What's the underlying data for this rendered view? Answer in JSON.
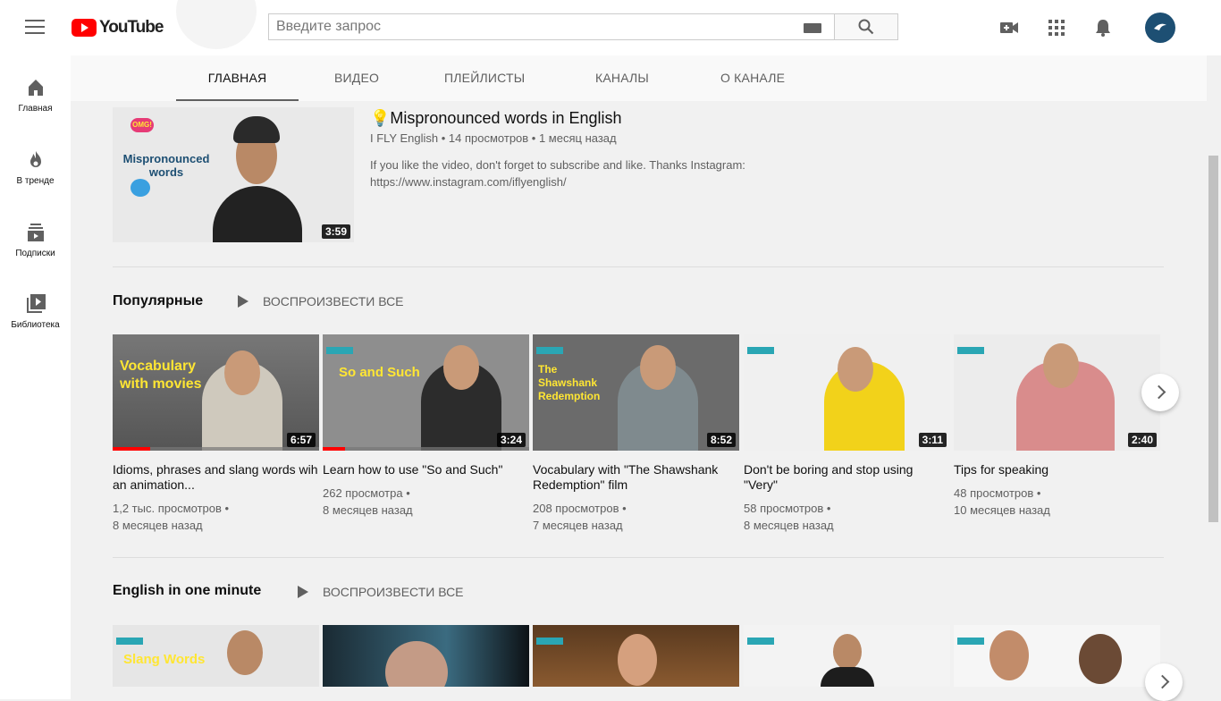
{
  "header": {
    "logo_text": "YouTube",
    "search_placeholder": "Введите запрос",
    "icons": [
      "menu-icon",
      "keyboard-icon",
      "search-icon",
      "create-video-icon",
      "apps-icon",
      "notifications-icon",
      "avatar"
    ]
  },
  "sidebar": {
    "items": [
      {
        "label": "Главная",
        "icon": "home-icon"
      },
      {
        "label": "В тренде",
        "icon": "fire-icon"
      },
      {
        "label": "Подписки",
        "icon": "subscriptions-icon"
      },
      {
        "label": "Библиотека",
        "icon": "library-icon"
      }
    ]
  },
  "tabs": [
    "ГЛАВНАЯ",
    "ВИДЕО",
    "ПЛЕЙЛИСТЫ",
    "КАНАЛЫ",
    "О КАНАЛЕ"
  ],
  "featured": {
    "title": "💡Mispronounced words in English",
    "channel": "I FLY English",
    "views": "14 просмотров",
    "age": "1 месяц назад",
    "description": "If you like the video, don't forget to subscribe and like. Thanks Instagram: https://www.instagram.com/iflyenglish/",
    "duration": "3:59",
    "thumb_caption": "Mispronounced words",
    "thumb_badge": "OMG!"
  },
  "shelves": [
    {
      "title": "Популярные",
      "play_all": "ВОСПРОИЗВЕСТИ ВСЕ",
      "videos": [
        {
          "title": "Idioms, phrases and slang words wih an animation...",
          "views": "1,2 тыс. просмотров",
          "age": "8 месяцев назад",
          "duration": "6:57",
          "caption": "Vocabulary with movies",
          "watched": 0.18
        },
        {
          "title": "Learn how to use \"So and Such\"",
          "views": "262 просмотра",
          "age": "8 месяцев назад",
          "duration": "3:24",
          "caption": "So and Such",
          "watched": 0.11
        },
        {
          "title": "Vocabulary with \"The Shawshank Redemption\" film",
          "views": "208 просмотров",
          "age": "7 месяцев назад",
          "duration": "8:52",
          "caption": "The Shawshank Redemption",
          "watched": 0
        },
        {
          "title": "Don't be boring and stop using \"Very\"",
          "views": "58 просмотров",
          "age": "8 месяцев назад",
          "duration": "3:11",
          "caption": "",
          "watched": 0
        },
        {
          "title": "Tips for speaking",
          "views": "48 просмотров",
          "age": "10 месяцев назад",
          "duration": "2:40",
          "caption": "",
          "watched": 0
        }
      ]
    },
    {
      "title": "English in one minute",
      "play_all": "ВОСПРОИЗВЕСТИ ВСЕ",
      "videos": [
        {
          "caption": "Slang Words"
        },
        {
          "caption": ""
        },
        {
          "caption": ""
        },
        {
          "caption": ""
        },
        {
          "caption": ""
        }
      ]
    }
  ],
  "colors": {
    "accent": "#ff0000",
    "badge": "#2aa6b4",
    "caption": "#ffe633"
  }
}
